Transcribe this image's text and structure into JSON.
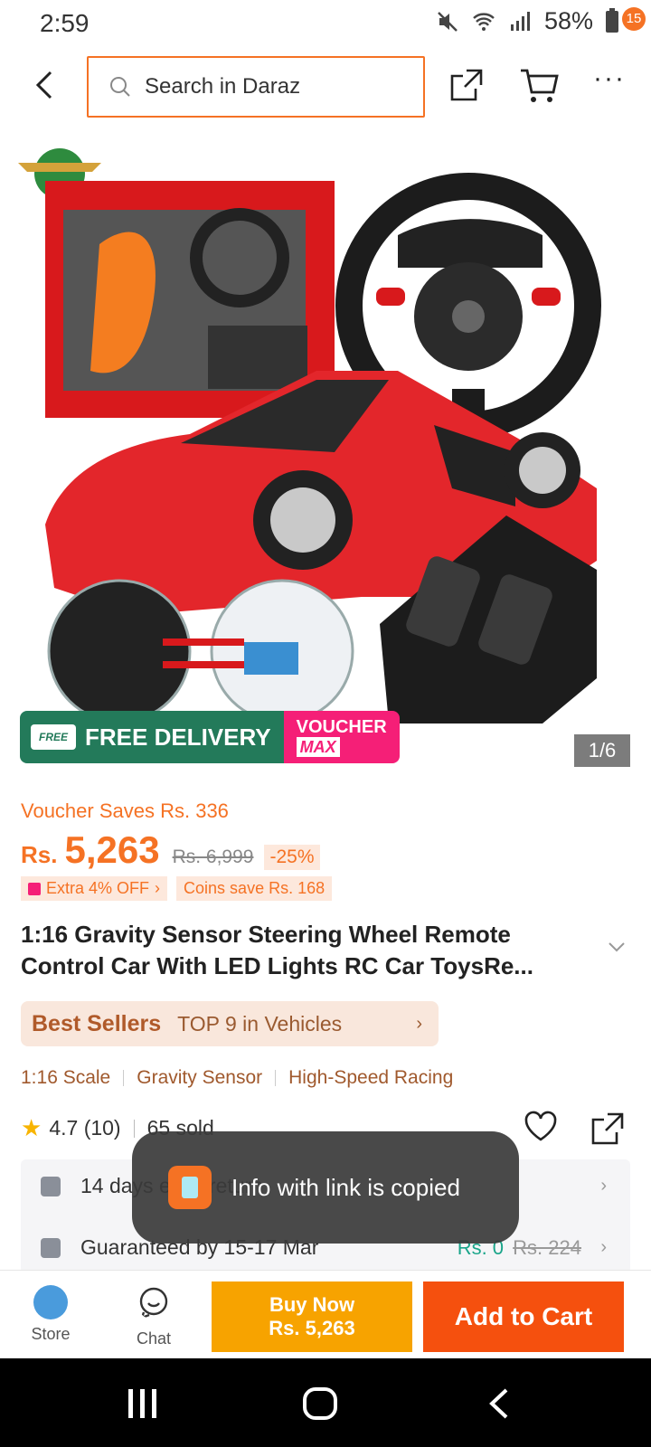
{
  "status_bar": {
    "time": "2:59",
    "battery": "58%"
  },
  "header": {
    "search_placeholder": "Search in Daraz",
    "cart_badge": "15"
  },
  "gallery": {
    "counter": "1/6",
    "promo_free": "FREE",
    "promo_delivery": "FREE DELIVERY",
    "promo_voucher": "VOUCHER",
    "promo_max": "MAX"
  },
  "pricing": {
    "voucher_saves": "Voucher Saves Rs. 336",
    "currency": "Rs.",
    "price": "5,263",
    "original_price": "Rs. 6,999",
    "discount": "-25%",
    "extra_off": "Extra 4% OFF",
    "coins_save": "Coins save Rs. 168"
  },
  "product": {
    "title": "1:16 Gravity Sensor Steering Wheel Remote Control Car With LED Lights RC Car ToysRe...",
    "best_sellers_label": "Best Sellers",
    "best_sellers_rank": "TOP 9 in Vehicles",
    "features": [
      "1:16 Scale",
      "Gravity Sensor",
      "High-Speed Racing"
    ],
    "rating": "4.7",
    "rating_count": "(10)",
    "sold": "65 sold"
  },
  "services": {
    "returns": "14 days easy return",
    "guarantee": "Guaranteed by 15-17 Mar",
    "shipping_price": "Rs. 0",
    "shipping_original": "Rs. 224"
  },
  "toast": {
    "message": "Info with link is copied"
  },
  "bottom_bar": {
    "store_label": "Store",
    "chat_label": "Chat",
    "buy_now_label": "Buy Now",
    "buy_now_price": "Rs. 5,263",
    "add_to_cart_label": "Add to Cart"
  },
  "colors": {
    "accent": "#f57224",
    "buy_now": "#f7a300",
    "add_to_cart": "#f5500e",
    "free_delivery": "#237a5a",
    "voucher_max": "#f51f77"
  }
}
